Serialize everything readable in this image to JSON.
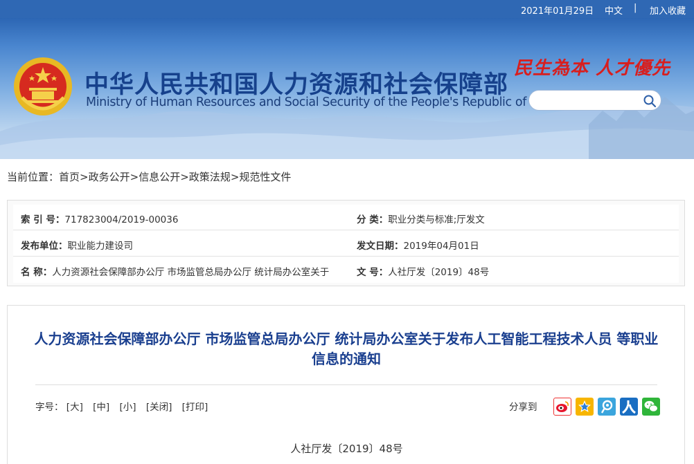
{
  "topbar": {
    "date": "2021年01月29日",
    "lang": "中文",
    "separator": "|",
    "favorite": "加入收藏"
  },
  "header": {
    "title_cn": "中华人民共和国人力资源和社会保障部",
    "title_en": "Ministry of Human Resources and Social Security of the People's Republic of China",
    "slogan": "民生為本 人才優先",
    "search_placeholder": ""
  },
  "breadcrumb": {
    "prefix": "当前位置：",
    "items": [
      "首页",
      "政务公开",
      "信息公开",
      "政策法规",
      "规范性文件"
    ],
    "sep": ">"
  },
  "info": {
    "index_label": "索 引 号：",
    "index_value": "717823004/2019-00036",
    "category_label": "分 类：",
    "category_value": "职业分类与标准;厅发文",
    "publisher_label": "发布单位：",
    "publisher_value": "职业能力建设司",
    "date_label": "发文日期：",
    "date_value": "2019年04月01日",
    "name_label": "名 称：",
    "name_value": "人力资源社会保障部办公厅 市场监管总局办公厅 统计局办公室关于",
    "docno_label": "文 号：",
    "docno_value": "人社厅发〔2019〕48号"
  },
  "article": {
    "title": "人力资源社会保障部办公厅 市场监管总局办公厅 统计局办公室关于发布人工智能工程技术人员 等职业信息的通知",
    "fontsize_label": "字号：",
    "options": [
      "[大]",
      "[中]",
      "[小]",
      "[关闭]",
      "[打印]"
    ],
    "share_label": "分享到",
    "doc_no": "人社厅发〔2019〕48号"
  },
  "colors": {
    "topbar": "#2f68b4",
    "title": "#16418c",
    "slogan": "#d81e1e",
    "article_title": "#1a3f8f"
  },
  "icons": [
    "emblem-icon",
    "search-icon",
    "weibo-icon",
    "qzone-icon",
    "tencent-weibo-icon",
    "renren-icon",
    "wechat-icon"
  ]
}
